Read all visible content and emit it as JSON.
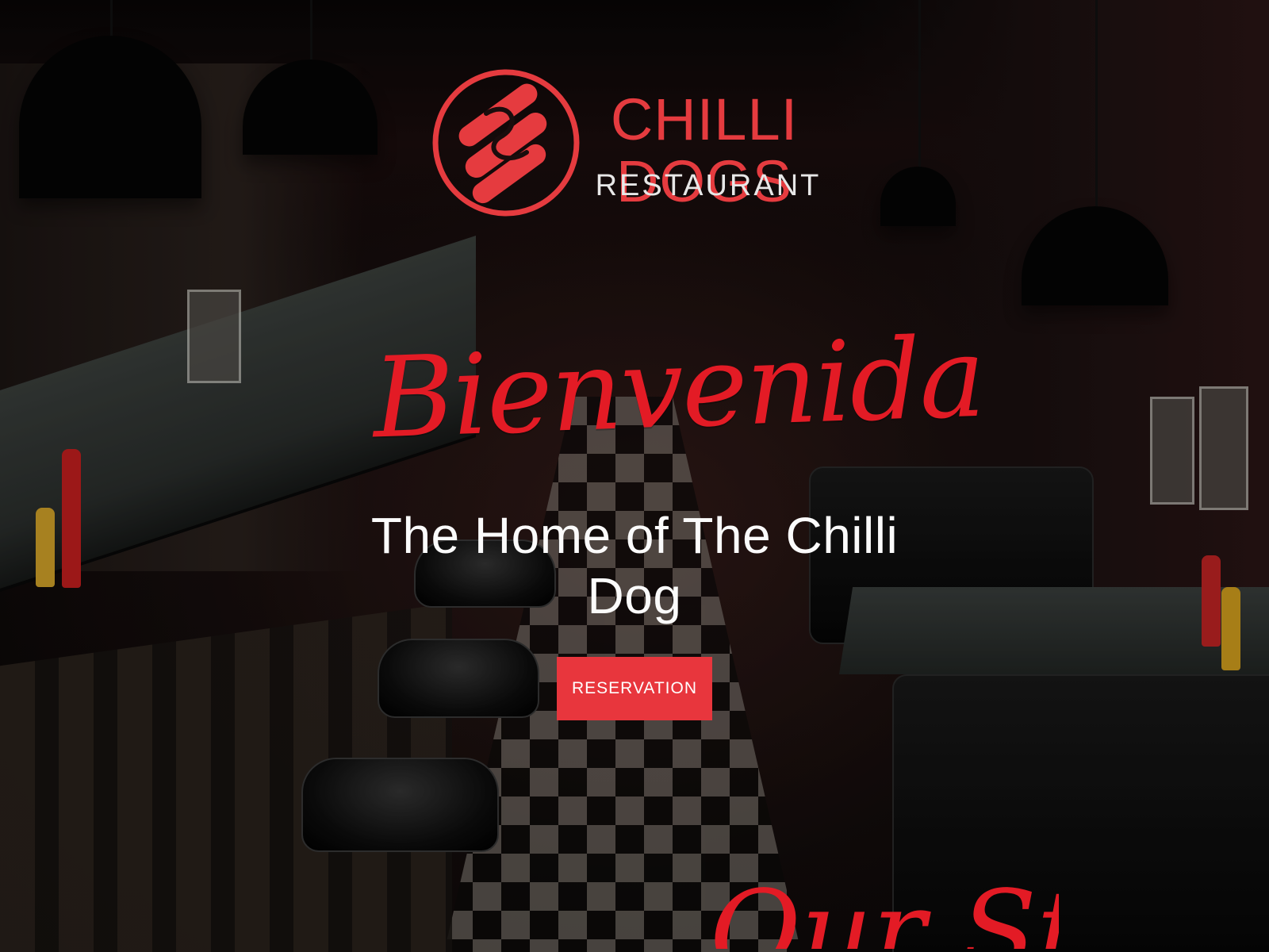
{
  "brand": {
    "name": "CHILLI DOGS",
    "subtitle": "RESTAURANT",
    "logo_icon": "hot-dog-icon",
    "accent_color": "#e53b3f"
  },
  "hero": {
    "welcome_text": "Bienvenida",
    "tagline": "The Home of The Chilli Dog",
    "reservation_button_label": "RESERVATION",
    "next_section_heading": "Our Story"
  },
  "colors": {
    "primary_red": "#e31b25",
    "button_red": "#e8363d",
    "text_white": "#fbfbfb",
    "dark_overlay": "#000000"
  }
}
